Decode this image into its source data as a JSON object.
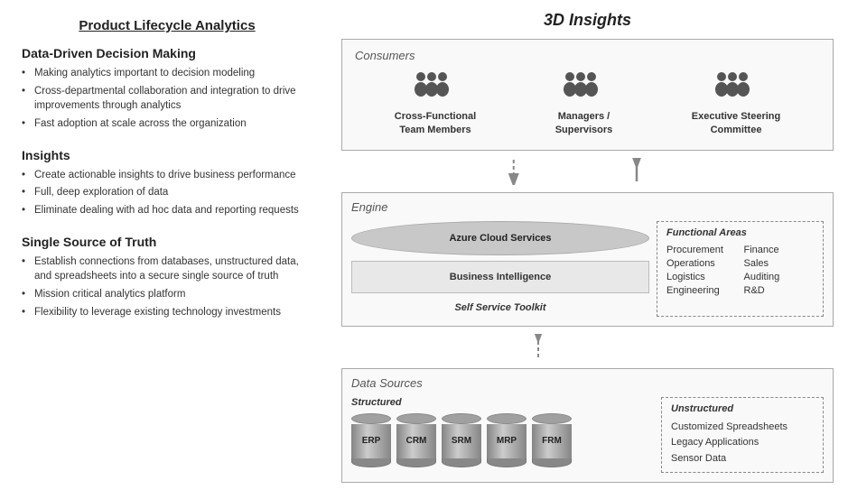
{
  "left": {
    "title": "Product Lifecycle Analytics",
    "section1": {
      "heading": "Data-Driven Decision Making",
      "bullets": [
        "Making analytics important to decision modeling",
        "Cross-departmental collaboration and integration to drive improvements through analytics",
        "Fast adoption at scale across the organization"
      ]
    },
    "section2": {
      "heading": "Insights",
      "bullets": [
        "Create actionable insights to drive business performance",
        "Full, deep exploration of data",
        "Eliminate dealing with ad hoc data and reporting requests"
      ]
    },
    "section3": {
      "heading": "Single Source of Truth",
      "bullets": [
        "Establish connections from databases, unstructured data, and spreadsheets into a secure single source of truth",
        "Mission critical analytics platform",
        "Flexibility to leverage existing technology investments"
      ]
    }
  },
  "right": {
    "main_title": "3D Insights",
    "consumers": {
      "label": "Consumers",
      "items": [
        {
          "icon": "👥",
          "label": "Cross-Functional\nTeam Members"
        },
        {
          "icon": "👥",
          "label": "Managers /\nSupervisors"
        },
        {
          "icon": "👥",
          "label": "Executive Steering\nCommittee"
        }
      ]
    },
    "engine": {
      "label": "Engine",
      "azure_label": "Azure Cloud Services",
      "bi_label": "Business Intelligence",
      "sst_label": "Self Service Toolkit",
      "functional": {
        "title": "Functional Areas",
        "items": [
          "Procurement",
          "Finance",
          "Operations",
          "Sales",
          "Logistics",
          "Auditing",
          "Engineering",
          "R&D"
        ]
      }
    },
    "datasources": {
      "label": "Data Sources",
      "structured": {
        "title": "Structured",
        "cylinders": [
          "ERP",
          "CRM",
          "SRM",
          "MRP",
          "FRM"
        ]
      },
      "unstructured": {
        "title": "Unstructured",
        "items": [
          "Customized Spreadsheets",
          "Legacy Applications",
          "Sensor Data"
        ]
      }
    }
  }
}
